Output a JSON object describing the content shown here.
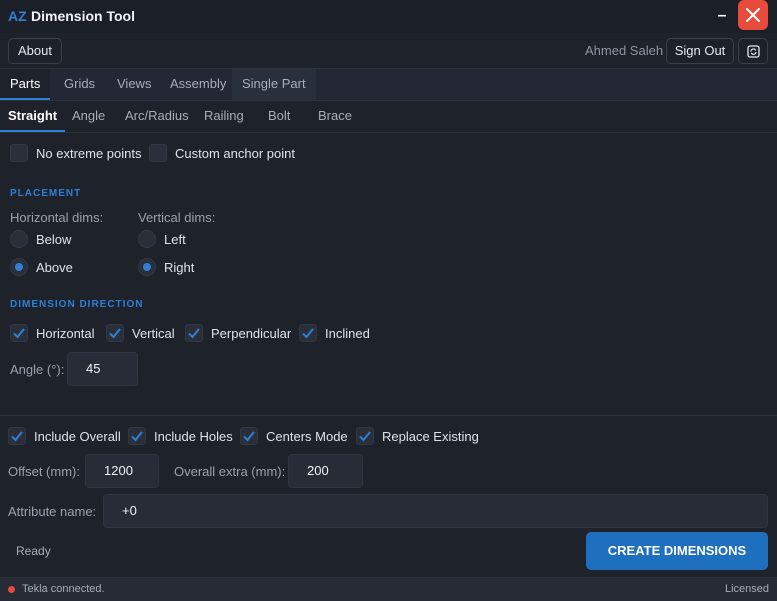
{
  "titlebar": {
    "logo": "AZ",
    "title": "Dimension Tool",
    "minimize_glyph": "–",
    "close_icon": "close-icon",
    "close_color": "#e84b3c"
  },
  "topbar": {
    "about_label": "About",
    "user_name": "Ahmed Saleh",
    "signout_label": "Sign Out",
    "extra_icon": "refresh-icon"
  },
  "main_tabs": [
    {
      "label": "Parts",
      "active": true
    },
    {
      "label": "Grids",
      "active": false
    },
    {
      "label": "Views",
      "active": false
    },
    {
      "label": "Assembly",
      "active": false
    },
    {
      "label": "Single Part",
      "active": false
    }
  ],
  "sub_tabs": [
    {
      "label": "Straight",
      "active": true
    },
    {
      "label": "Angle",
      "active": false
    },
    {
      "label": "Arc/Radius",
      "active": false
    },
    {
      "label": "Railing",
      "active": false
    },
    {
      "label": "Bolt",
      "active": false
    },
    {
      "label": "Brace",
      "active": false
    }
  ],
  "options": {
    "no_extreme_points": {
      "label": "No extreme points",
      "checked": false
    },
    "custom_anchor_point": {
      "label": "Custom anchor point",
      "checked": false
    }
  },
  "placement": {
    "title": "PLACEMENT",
    "horizontal_label": "Horizontal dims:",
    "vertical_label": "Vertical dims:",
    "horizontal_options": [
      {
        "label": "Below",
        "selected": false
      },
      {
        "label": "Above",
        "selected": true
      }
    ],
    "vertical_options": [
      {
        "label": "Left",
        "selected": false
      },
      {
        "label": "Right",
        "selected": true
      }
    ]
  },
  "direction": {
    "title": "DIMENSION DIRECTION",
    "items": [
      {
        "label": "Horizontal",
        "checked": true
      },
      {
        "label": "Vertical",
        "checked": true
      },
      {
        "label": "Perpendicular",
        "checked": true
      },
      {
        "label": "Inclined",
        "checked": true
      }
    ],
    "angle_label": "Angle (°):",
    "angle_value": "45"
  },
  "bottom_options": {
    "items": [
      {
        "label": "Include Overall",
        "checked": true
      },
      {
        "label": "Include Holes",
        "checked": true
      },
      {
        "label": "Centers Mode",
        "checked": true
      },
      {
        "label": "Replace Existing",
        "checked": true
      }
    ],
    "offset_label": "Offset (mm):",
    "offset_value": "1200",
    "overall_extra_label": "Overall extra (mm):",
    "overall_extra_value": "200",
    "attribute_label": "Attribute name:",
    "attribute_value": "+0"
  },
  "status": "Ready",
  "create_button": "CREATE DIMENSIONS",
  "accent_color": "#2f7fd6",
  "footer": {
    "connection_text": "Tekla connected.",
    "connection_color": "#e84b3c",
    "license_text": "Licensed"
  }
}
